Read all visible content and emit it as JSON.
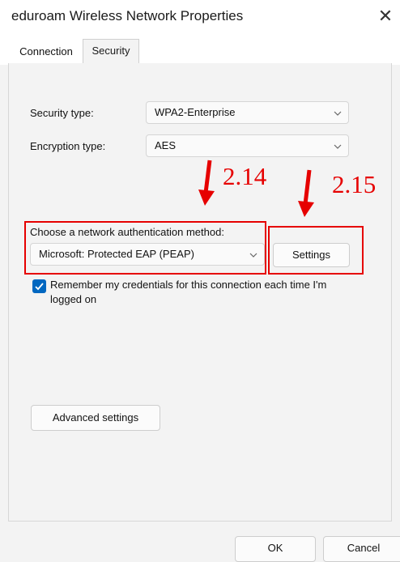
{
  "window": {
    "title": "eduroam Wireless Network Properties",
    "close_glyph": "✕"
  },
  "tabs": [
    {
      "label": "Connection"
    },
    {
      "label": "Security"
    }
  ],
  "security": {
    "security_type_label": "Security type:",
    "security_type_value": "WPA2-Enterprise",
    "encryption_type_label": "Encryption type:",
    "encryption_type_value": "AES",
    "auth_method_label": "Choose a network authentication method:",
    "auth_method_value": "Microsoft: Protected EAP (PEAP)",
    "settings_button": "Settings",
    "remember_label": "Remember my credentials for this connection each time I'm logged on",
    "remember_checked": true,
    "advanced_button": "Advanced settings"
  },
  "annotations": {
    "step_a": "2.14",
    "step_b": "2.15",
    "color": "#e60000"
  },
  "footer": {
    "ok_label": "OK",
    "cancel_label": "Cancel"
  },
  "colors": {
    "accent": "#0067c0",
    "annotation": "#e60000"
  },
  "icons": {
    "close": "close-icon",
    "chevron": "chevron-down-icon",
    "check": "checkmark-icon",
    "arrow": "arrow-down-icon"
  }
}
